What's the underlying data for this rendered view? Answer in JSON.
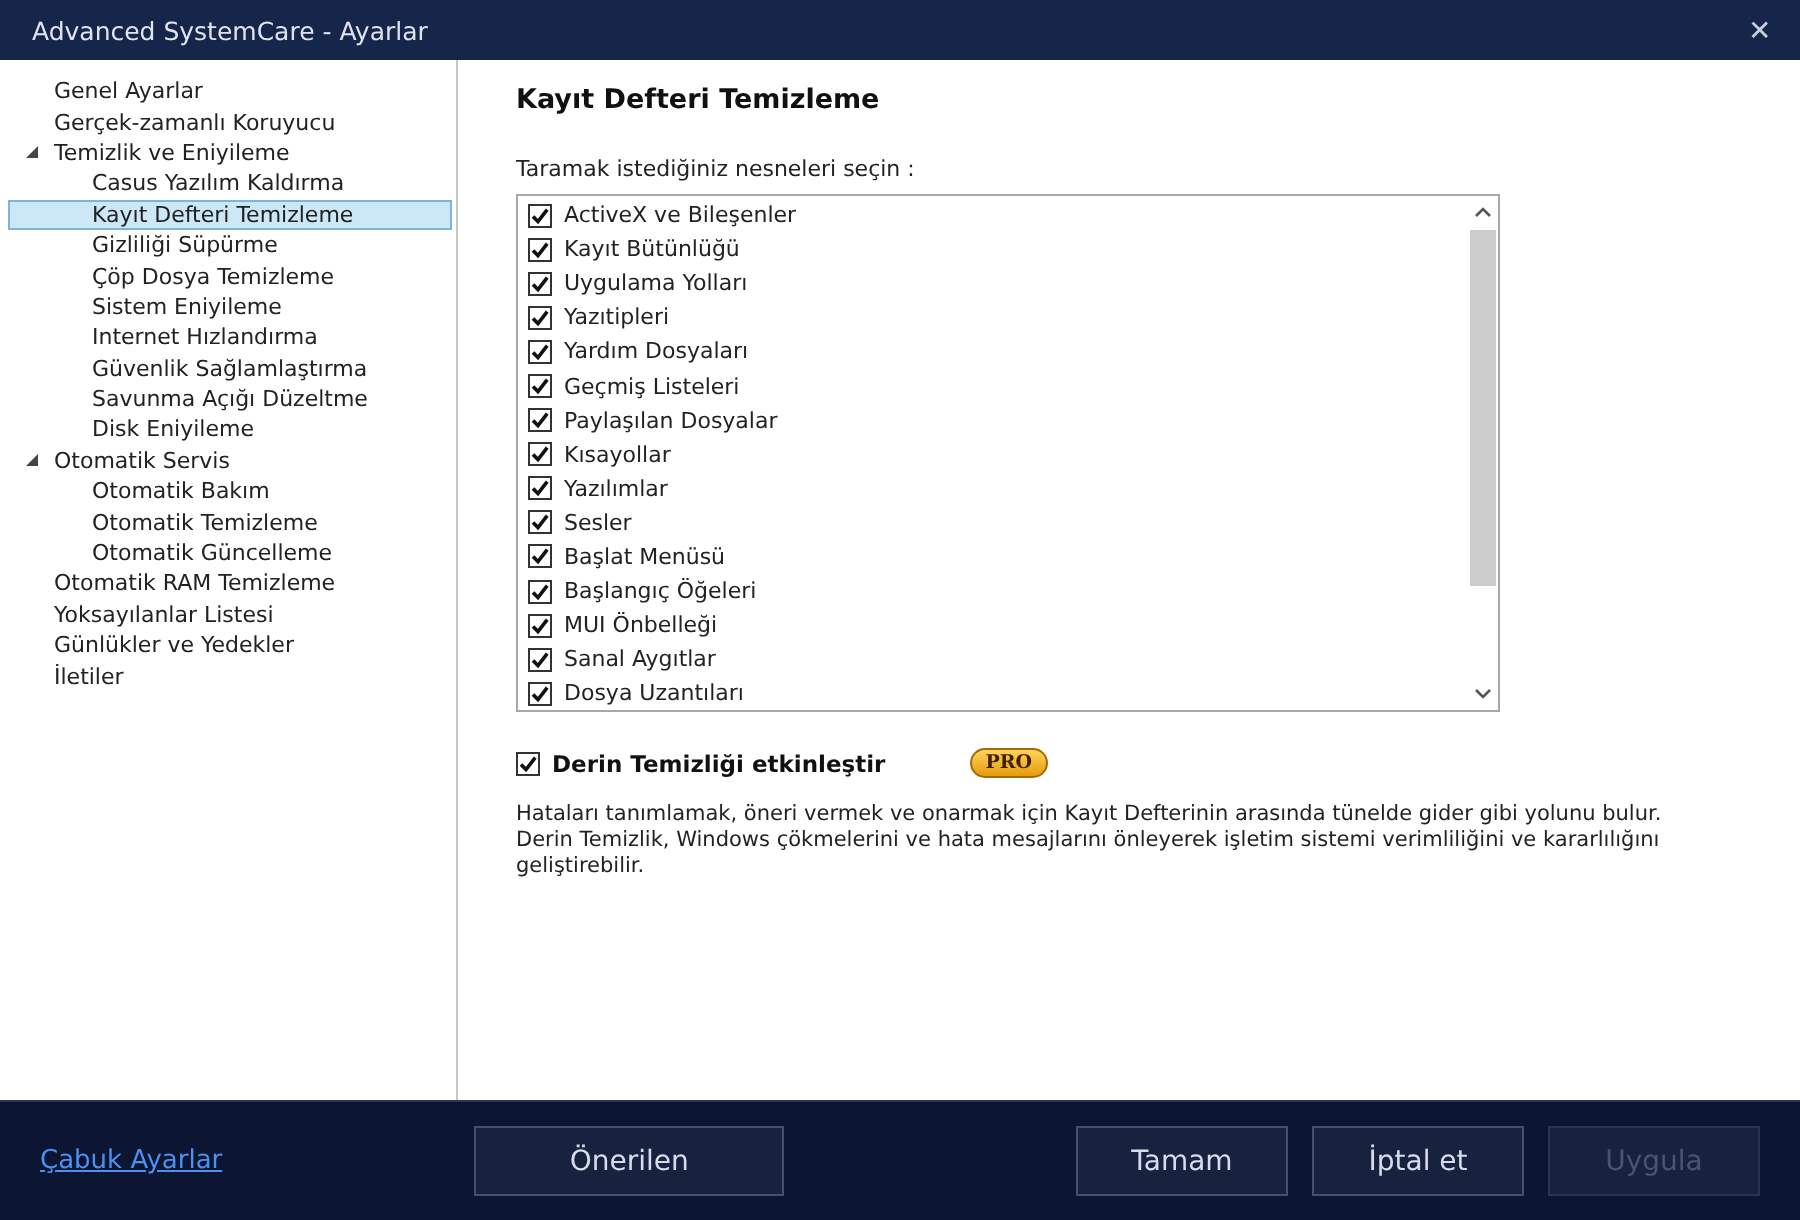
{
  "window": {
    "title": "Advanced SystemCare - Ayarlar",
    "close": "✕"
  },
  "sidebar": {
    "items": [
      {
        "label": "Genel Ayarlar",
        "selected": false
      },
      {
        "label": "Gerçek-zamanlı Koruyucu",
        "selected": false
      },
      {
        "label": "Temizlik ve Eniyileme",
        "selected": false,
        "expanded": true,
        "children": [
          {
            "label": "Casus Yazılım Kaldırma",
            "selected": false
          },
          {
            "label": "Kayıt Defteri Temizleme",
            "selected": true
          },
          {
            "label": "Gizliliği Süpürme",
            "selected": false
          },
          {
            "label": "Çöp Dosya Temizleme",
            "selected": false
          },
          {
            "label": "Sistem Eniyileme",
            "selected": false
          },
          {
            "label": "Internet Hızlandırma",
            "selected": false
          },
          {
            "label": "Güvenlik Sağlamlaştırma",
            "selected": false
          },
          {
            "label": "Savunma Açığı Düzeltme",
            "selected": false
          },
          {
            "label": "Disk Eniyileme",
            "selected": false
          }
        ]
      },
      {
        "label": "Otomatik Servis",
        "selected": false,
        "expanded": true,
        "children": [
          {
            "label": "Otomatik Bakım",
            "selected": false
          },
          {
            "label": "Otomatik Temizleme",
            "selected": false
          },
          {
            "label": "Otomatik Güncelleme",
            "selected": false
          }
        ]
      },
      {
        "label": "Otomatik RAM Temizleme",
        "selected": false
      },
      {
        "label": "Yoksayılanlar Listesi",
        "selected": false
      },
      {
        "label": "Günlükler ve Yedekler",
        "selected": false
      },
      {
        "label": "İletiler",
        "selected": false
      }
    ]
  },
  "content": {
    "heading": "Kayıt Defteri Temizleme",
    "prompt": "Taramak istediğiniz nesneleri seçin :",
    "items": [
      {
        "label": "ActiveX ve Bileşenler",
        "checked": true
      },
      {
        "label": "Kayıt Bütünlüğü",
        "checked": true
      },
      {
        "label": "Uygulama Yolları",
        "checked": true
      },
      {
        "label": "Yazıtipleri",
        "checked": true
      },
      {
        "label": "Yardım Dosyaları",
        "checked": true
      },
      {
        "label": "Geçmiş Listeleri",
        "checked": true
      },
      {
        "label": "Paylaşılan Dosyalar",
        "checked": true
      },
      {
        "label": "Kısayollar",
        "checked": true
      },
      {
        "label": "Yazılımlar",
        "checked": true
      },
      {
        "label": "Sesler",
        "checked": true
      },
      {
        "label": "Başlat Menüsü",
        "checked": true
      },
      {
        "label": "Başlangıç Öğeleri",
        "checked": true
      },
      {
        "label": "MUI Önbelleği",
        "checked": true
      },
      {
        "label": "Sanal Aygıtlar",
        "checked": true
      },
      {
        "label": "Dosya Uzantıları",
        "checked": true
      }
    ],
    "deep_clean": {
      "label": "Derin Temizliği etkinleştir",
      "checked": true,
      "badge": "PRO"
    },
    "description": "Hataları tanımlamak, öneri vermek ve onarmak için Kayıt Defterinin arasında tünelde gider gibi yolunu bulur.\nDerin Temizlik, Windows çökmelerini ve hata mesajlarını önleyerek işletim sistemi verimliliğini ve kararlılığını geliştirebilir."
  },
  "footer": {
    "link": "Çabuk Ayarlar",
    "buttons": [
      {
        "label": "Önerilen",
        "disabled": false
      },
      {
        "label": "Tamam",
        "disabled": false
      },
      {
        "label": "İptal et",
        "disabled": false
      },
      {
        "label": "Uygula",
        "disabled": true
      }
    ]
  }
}
